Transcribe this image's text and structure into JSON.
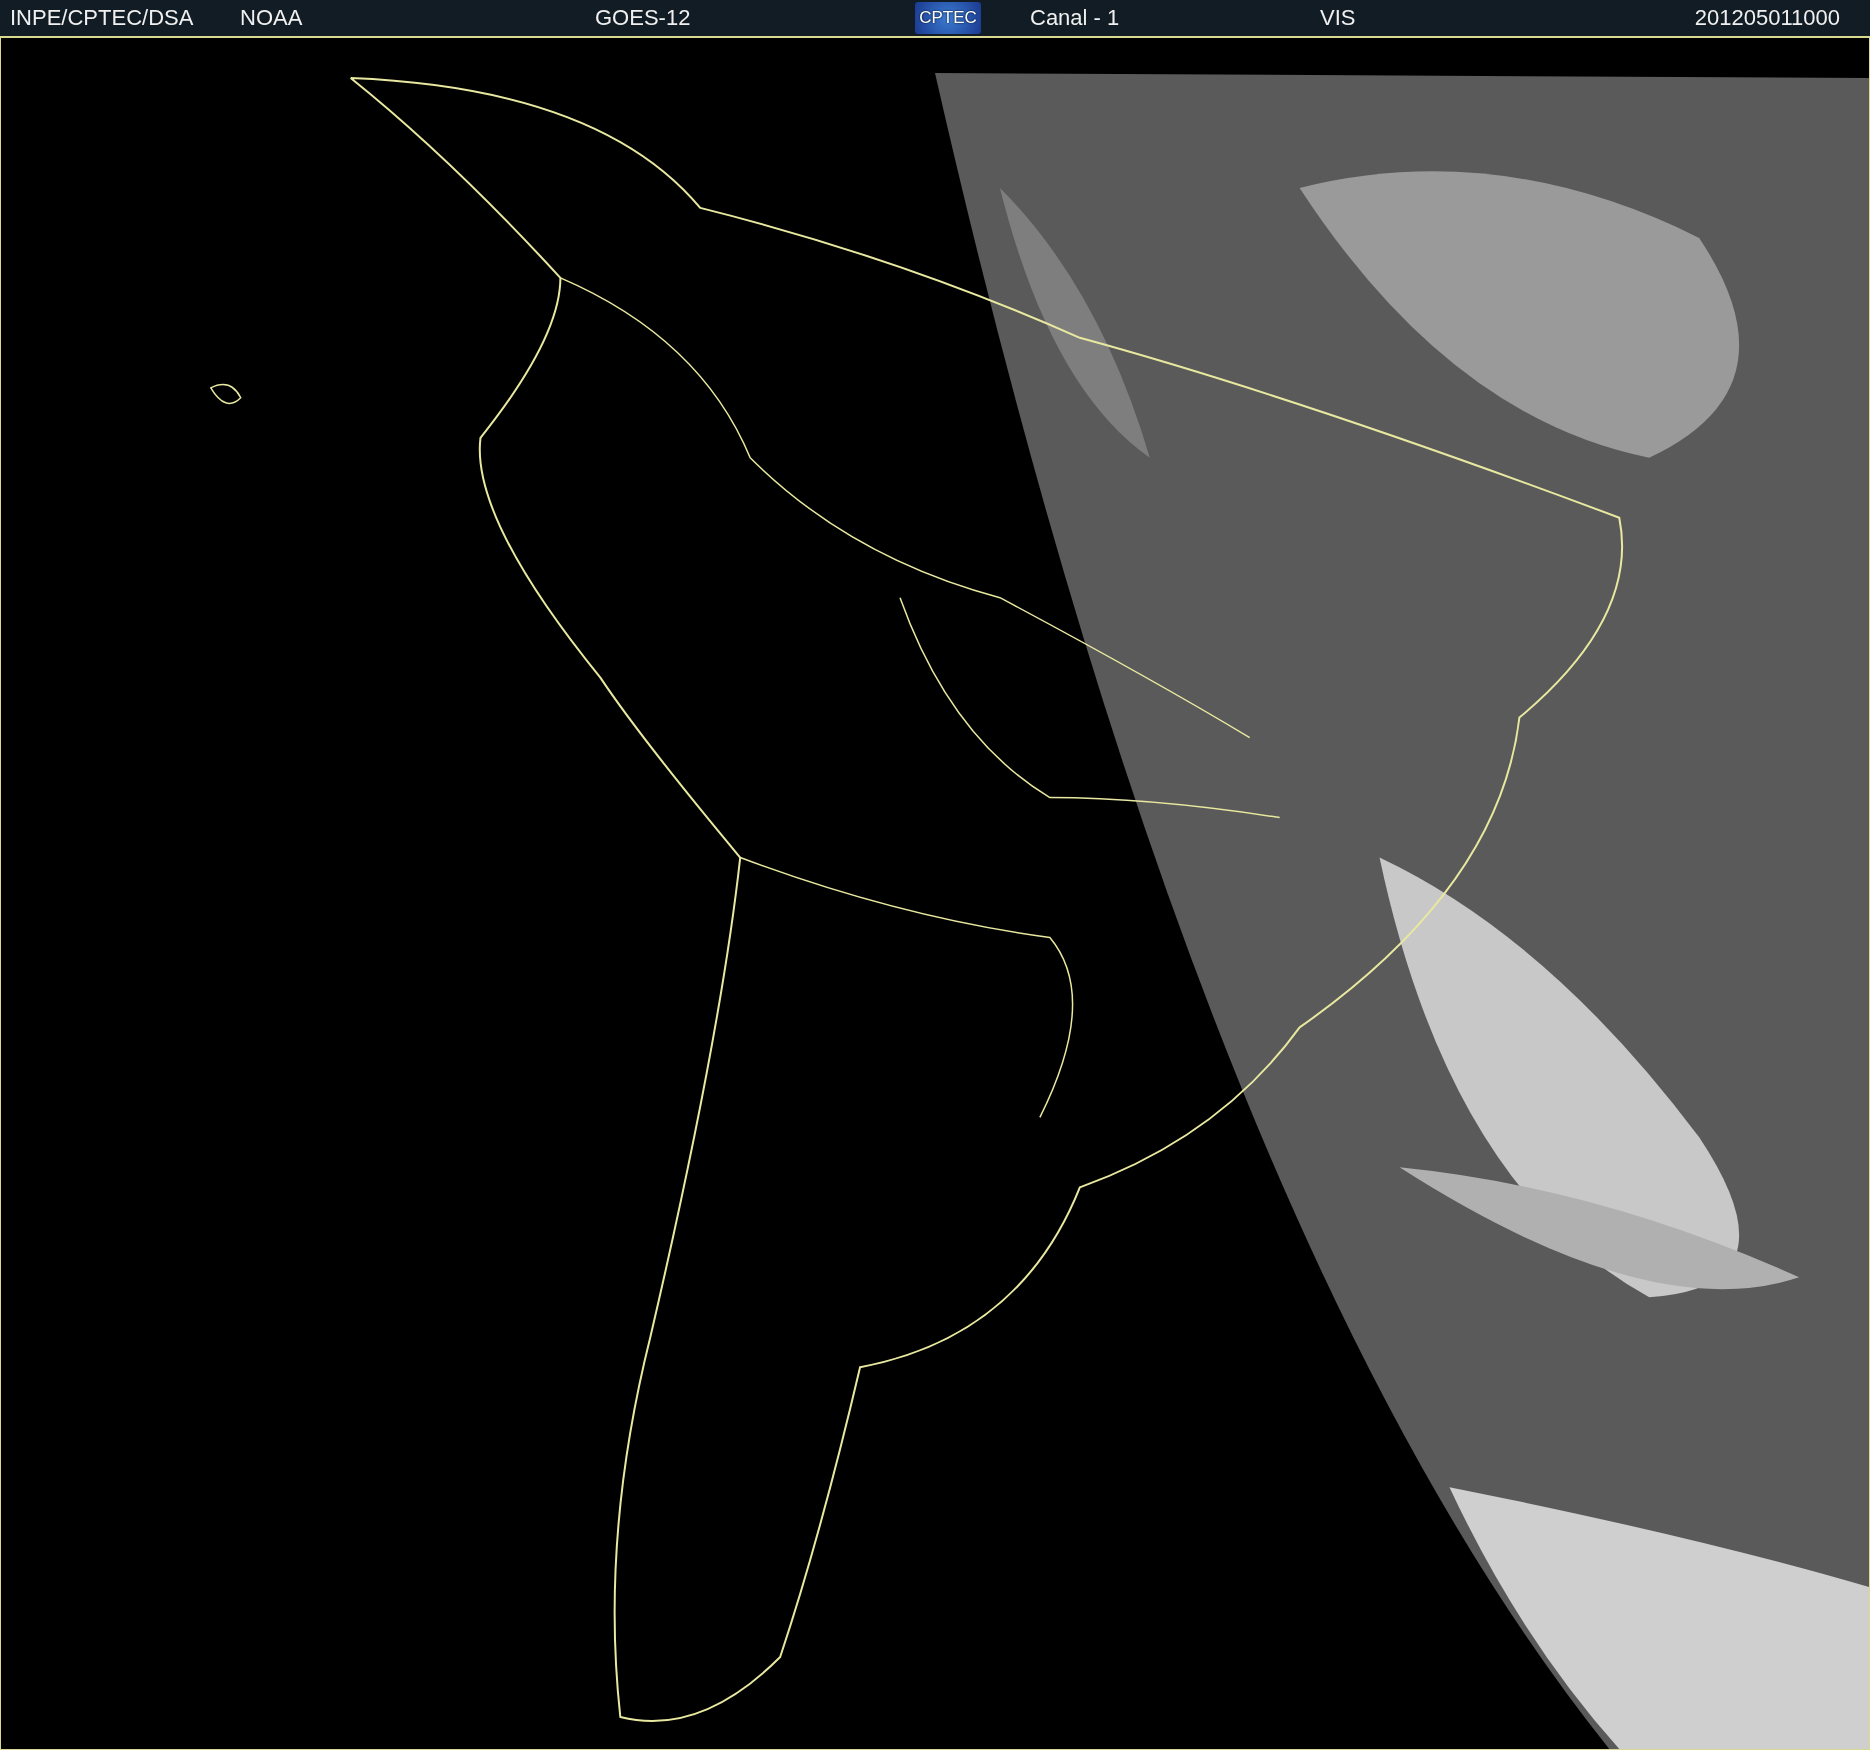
{
  "header": {
    "source": "INPE/CPTEC/DSA",
    "agency": "NOAA",
    "satellite": "GOES-12",
    "logo": "CPTEC",
    "channel": "Canal - 1",
    "band": "VIS",
    "timestamp": "201205011000"
  }
}
